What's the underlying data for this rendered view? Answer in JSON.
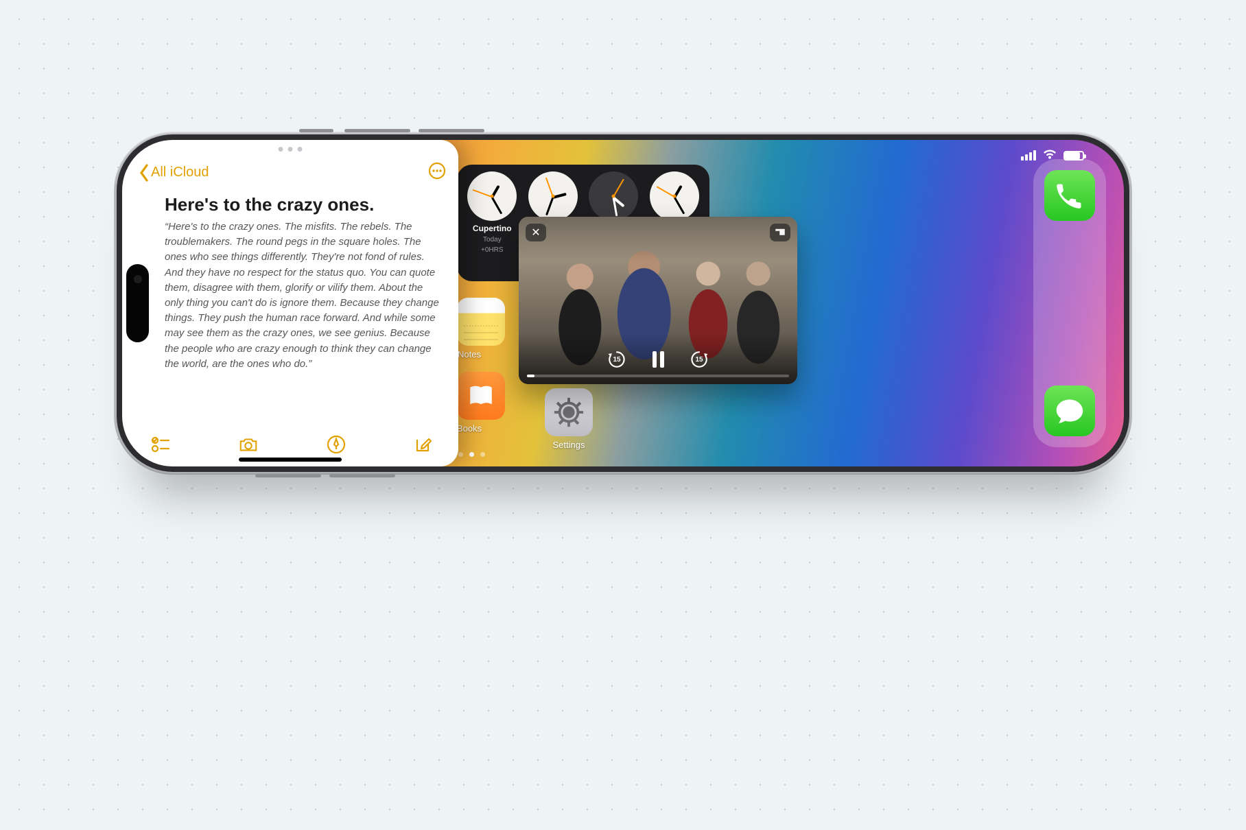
{
  "status": {
    "signal_bars": 4,
    "wifi": true,
    "battery_pct": 85
  },
  "notes_panel": {
    "back_label": "All iCloud",
    "grabber_dots": 3,
    "title": "Here's to the crazy ones.",
    "body": "“Here's to the crazy ones. The misfits. The rebels. The troublemakers. The round pegs in the square holes. The ones who see things differently. They're not fond of rules. And they have no respect for the status quo. You can quote them, disagree with them, glorify or vilify them. About the only thing you can't do is ignore them. Because they change things. They push the human race forward. And while some may see them as the crazy ones, we see genius. Because the people who are crazy enough to think they can change the world, are the ones who do.”",
    "toolbar": {
      "checklist_icon": "checklist",
      "camera_icon": "camera",
      "markup_icon": "markup-pen",
      "compose_icon": "compose"
    }
  },
  "clock_widget": {
    "cities": [
      {
        "name": "Cupertino",
        "day_label": "Today",
        "offset": "+0HRS",
        "is_day": true,
        "h_deg": 300,
        "m_deg": 60,
        "s_deg": 200
      },
      {
        "name": "",
        "day_label": "",
        "offset": "",
        "is_day": true,
        "h_deg": 345,
        "m_deg": 110,
        "s_deg": 250
      },
      {
        "name": "",
        "day_label": "",
        "offset": "",
        "is_day": false,
        "h_deg": 40,
        "m_deg": 80,
        "s_deg": 300
      },
      {
        "name": "",
        "day_label": "",
        "offset": "",
        "is_day": true,
        "h_deg": 300,
        "m_deg": 60,
        "s_deg": 210
      }
    ]
  },
  "pip": {
    "close_icon": "✕",
    "expand_icon": "pip-expand",
    "skip_back_seconds": "15",
    "skip_fwd_seconds": "15",
    "state": "paused_visible_pause_icon",
    "progress_pct": 3
  },
  "home": {
    "apps_left": [
      {
        "label": "Notes",
        "icon": "notes-app"
      },
      {
        "label": "Books",
        "icon": "books-app"
      }
    ],
    "settings": {
      "label": "Settings",
      "icon": "settings-app"
    },
    "dock": [
      {
        "label": "",
        "icon": "phone-app"
      },
      {
        "label": "",
        "icon": "messages-app"
      }
    ],
    "page_dots": {
      "count": 3,
      "active_index": 1
    }
  },
  "colors": {
    "accent_notes": "#e2a100",
    "ios_green": "#27c722"
  }
}
